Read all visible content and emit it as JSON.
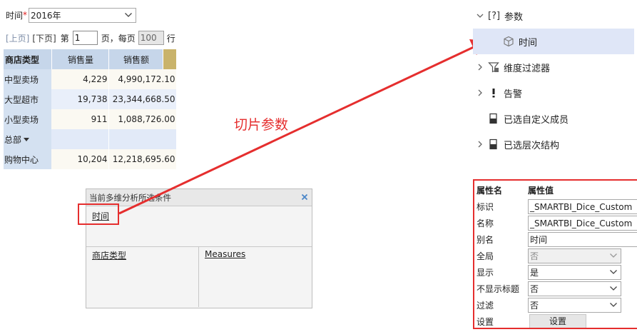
{
  "filter": {
    "label": "时间",
    "required_mark": "*",
    "value": "2016年"
  },
  "pager": {
    "prev": "[上页]",
    "next": "[下页]",
    "page_prefix": "第",
    "page_value": "1",
    "page_suffix": "页，每页",
    "rows_value": "100",
    "rows_suffix": "行"
  },
  "table": {
    "headers": [
      "商店类型",
      "销售量",
      "销售额"
    ],
    "rows": [
      {
        "name": "中型卖场",
        "qty": "4,229",
        "amount": "4,990,172.10"
      },
      {
        "name": "大型超市",
        "qty": "19,738",
        "amount": "23,344,668.50"
      },
      {
        "name": "小型卖场",
        "qty": "911",
        "amount": "1,088,726.00"
      },
      {
        "name": "总部",
        "qty": "",
        "amount": ""
      },
      {
        "name": "购物中心",
        "qty": "10,204",
        "amount": "12,218,695.60"
      }
    ]
  },
  "conditions": {
    "title": "当前多维分析所选条件",
    "slice": "时间",
    "rows_dim": "商店类型",
    "cols_dim": "Measures"
  },
  "callout": {
    "label": "切片参数",
    "color": "#e52e2e"
  },
  "tree": {
    "root": {
      "prefix": "[?]",
      "label": "参数"
    },
    "child": {
      "label": "时间"
    },
    "items": [
      {
        "label": "维度过滤器"
      },
      {
        "label": "告警"
      },
      {
        "label": "已选自定义成员"
      },
      {
        "label": "已选层次结构"
      }
    ]
  },
  "properties": {
    "header_name": "属性名",
    "header_value": "属性值",
    "rows": [
      {
        "key": "标识",
        "value": "_SMARTBI_Dice_Custom"
      },
      {
        "key": "名称",
        "value": "_SMARTBI_Dice_Custom"
      },
      {
        "key": "别名",
        "value": "时间"
      },
      {
        "key": "全局",
        "value": "否"
      },
      {
        "key": "显示",
        "value": "是"
      },
      {
        "key": "不显示标题",
        "value": "否"
      },
      {
        "key": "过滤",
        "value": "否"
      },
      {
        "key": "设置",
        "value": "设置"
      }
    ]
  }
}
